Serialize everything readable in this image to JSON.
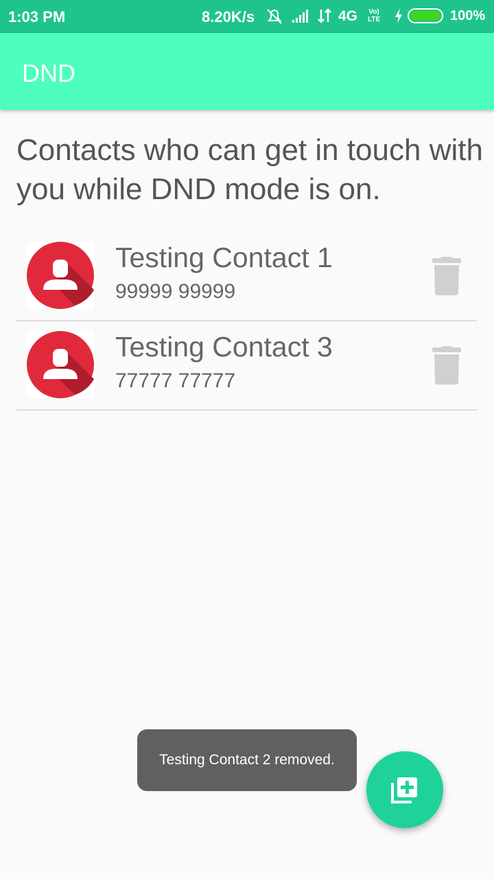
{
  "status_bar": {
    "time": "1:03 PM",
    "speed": "8.20K/s",
    "network": "4G",
    "volte_line1": "Vo)",
    "volte_line2": "LTE",
    "battery": "100%",
    "icons": [
      "alarm-off-icon",
      "signal-icon",
      "data-arrows-icon",
      "charging-icon",
      "battery-icon"
    ]
  },
  "app_bar": {
    "title": "DND"
  },
  "intro_text": "Contacts who can get in touch with you while DND mode is on.",
  "contacts": [
    {
      "name": "Testing Contact 1",
      "phone": "99999 99999"
    },
    {
      "name": "Testing Contact 3",
      "phone": "77777 77777"
    }
  ],
  "toast": "Testing Contact 2 removed.",
  "fab": {
    "icon": "add-contact-icon"
  },
  "colors": {
    "status_bar": "#1fc48c",
    "app_bar": "#4dfebd",
    "avatar": "#e02a3c",
    "fab": "#1fd299",
    "trash": "#d0d0d0"
  }
}
